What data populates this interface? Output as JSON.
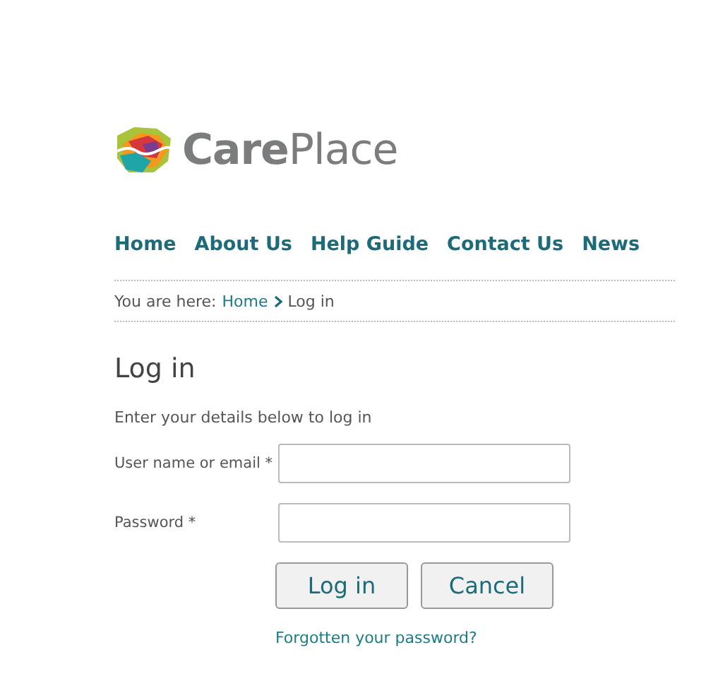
{
  "logo": {
    "text": "**Care**Place"
  },
  "nav": [
    {
      "label": "Home"
    },
    {
      "label": "About Us"
    },
    {
      "label": "Help Guide"
    },
    {
      "label": "Contact Us"
    },
    {
      "label": "News"
    }
  ],
  "breadcrumb": {
    "prefix": "You are here:",
    "items": [
      {
        "label": "Home",
        "kind": "link"
      },
      {
        "label": "Log in",
        "kind": "current"
      }
    ]
  },
  "login": {
    "title": "Log in",
    "intro": "Enter your details below to log in",
    "fields": [
      {
        "label": "User name or email *"
      },
      {
        "label": "Password *"
      }
    ],
    "buttons": [
      "Log in",
      "Cancel"
    ],
    "forgot_link": "Forgotten your password?"
  }
}
